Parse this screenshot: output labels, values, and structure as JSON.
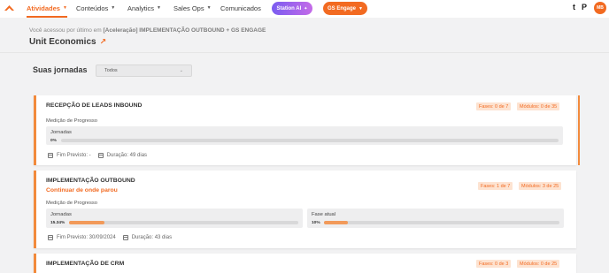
{
  "nav": {
    "items": [
      {
        "label": "Atividades",
        "dropdown": true,
        "active": true
      },
      {
        "label": "Conteúdos",
        "dropdown": true
      },
      {
        "label": "Analytics",
        "dropdown": true
      },
      {
        "label": "Sales Ops",
        "dropdown": true
      },
      {
        "label": "Comunicados",
        "dropdown": false
      }
    ],
    "station_ai_label": "Station AI",
    "station_ai_icon": "sparkle-icon",
    "gs_engage_label": "GS Engage",
    "gs_engage_icon": "chevron-down-icon",
    "icon_t": "t",
    "icon_p": "P",
    "avatar_initials": "MB",
    "accent": "#f26a21"
  },
  "header": {
    "recent_prefix": "Você acessou por último em",
    "recent_course": "[Aceleração] IMPLEMENTAÇÃO OUTBOUND + GS ENGAGE",
    "title": "Unit Economics",
    "title_icon": "external-arrow-icon"
  },
  "jornadas": {
    "title": "Suas jornadas",
    "filter_value": "Todos"
  },
  "cards": [
    {
      "title": "RECEPÇÃO DE LEADS INBOUND",
      "fases": "Fases: 0 de 7",
      "modulos": "Módulos: 0 de 35",
      "progress_label": "Medição de Progresso",
      "bars": [
        {
          "label": "Jornadas",
          "pct_text": "0%",
          "value": 0
        }
      ],
      "fim_previsto": "Fim Previsto: -",
      "duracao": "Duração: 49 dias"
    },
    {
      "title": "IMPLEMENTAÇÃO OUTBOUND",
      "continue_label": "Continuar de onde parou",
      "fases": "Fases: 1 de 7",
      "modulos": "Módulos: 3 de 25",
      "progress_label": "Medição de Progresso",
      "bars": [
        {
          "label": "Jornadas",
          "pct_text": "15.34%",
          "value": 15.34
        },
        {
          "label": "Fase atual",
          "pct_text": "10%",
          "value": 10
        }
      ],
      "fim_previsto": "Fim Previsto: 30/09/2024",
      "duracao": "Duração: 43 dias"
    },
    {
      "title": "IMPLEMENTAÇÃO DE CRM",
      "fases": "Fases: 0 de 3",
      "modulos": "Módulos: 0 de 25"
    }
  ]
}
